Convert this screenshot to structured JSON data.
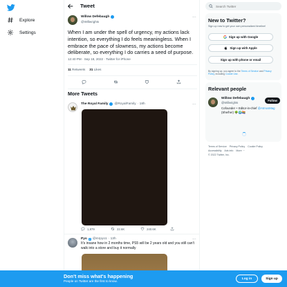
{
  "nav": {
    "explore_label": "Explore",
    "settings_label": "Settings"
  },
  "header": {
    "title": "Tweet"
  },
  "tweet": {
    "author_name": "Willow Defebaugh",
    "author_handle": "@Willwrights",
    "text": "When I am under the spell of urgency, my actions lack intention, so everything I do feels meaningless. When I embrace the pace of slowness, my actions become deliberate, so everything I do carries a seed of purpose.",
    "meta": "12:40 PM · Sep 18, 2022 · Twitter for iPhone",
    "retweets_count": "11",
    "retweets_label": "Retweets",
    "likes_count": "31",
    "likes_label": "Likes"
  },
  "more_tweets": {
    "heading": "More Tweets",
    "items": [
      {
        "name": "The Royal Family",
        "handle": "@RoyalFamily",
        "time": "· 18h",
        "replies": "1,879",
        "retweets": "22.6K",
        "likes": "240.6K"
      },
      {
        "name": "Pyo",
        "badge": "2",
        "handle": "@mrpyo1",
        "time": "· 13h",
        "text": "It's insane how in 2 months time, PS5 will be 2 years old and you still can't walk into a store and buy it normally"
      }
    ]
  },
  "search": {
    "placeholder": "Search Twitter"
  },
  "new_to_twitter": {
    "title": "New to Twitter?",
    "subtitle": "Sign up now to get your own personalized timeline!",
    "google_label": "Sign up with Google",
    "apple_label": "Sign up with Apple",
    "phone_label": "Sign up with phone or email",
    "terms_prefix": "By signing up, you agree to the ",
    "terms_link": "Terms of Service",
    "terms_and": " and ",
    "privacy_link": "Privacy Policy",
    "terms_mid": ", including ",
    "cookie_link": "Cookie Use",
    "terms_end": "."
  },
  "relevant_people": {
    "title": "Relevant people",
    "name": "Willow Defebaugh",
    "handle": "@Willwrights",
    "follow_label": "Follow",
    "bio_prefix": "Cofounder + Editor-in-chief ",
    "bio_link": "@AtmosMag",
    "bio_suffix": " (She/her) 🌳🌍🏳️‍🌈"
  },
  "footer": {
    "links": [
      "Terms of Service",
      "Privacy Policy",
      "Cookie Policy",
      "Accessibility",
      "Ads info",
      "More ···"
    ],
    "copyright": "© 2022 Twitter, Inc."
  },
  "bottom_bar": {
    "title": "Don't miss what's happening",
    "subtitle": "People on Twitter are the first to know.",
    "login_label": "Log in",
    "signup_label": "Sign up"
  },
  "colors": {
    "accent": "#1d9bf0",
    "text": "#0f1419",
    "muted": "#536471"
  }
}
